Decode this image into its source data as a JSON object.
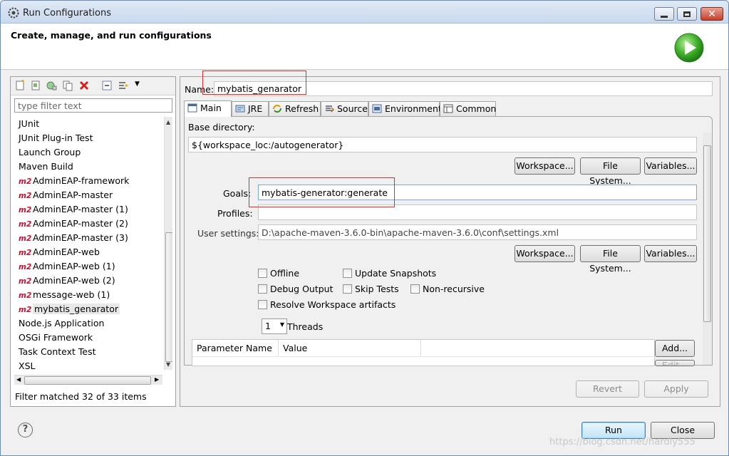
{
  "window": {
    "title": "Run Configurations",
    "header_title": "Create, manage, and run configurations"
  },
  "left": {
    "filter_placeholder": "type filter text",
    "items": [
      {
        "label": "JUnit",
        "m2": false
      },
      {
        "label": "JUnit Plug-in Test",
        "m2": false
      },
      {
        "label": "Launch Group",
        "m2": false
      },
      {
        "label": "Maven Build",
        "m2": false
      },
      {
        "label": "AdminEAP-framework",
        "m2": true
      },
      {
        "label": "AdminEAP-master",
        "m2": true
      },
      {
        "label": "AdminEAP-master (1)",
        "m2": true
      },
      {
        "label": "AdminEAP-master (2)",
        "m2": true
      },
      {
        "label": "AdminEAP-master (3)",
        "m2": true
      },
      {
        "label": "AdminEAP-web",
        "m2": true
      },
      {
        "label": "AdminEAP-web (1)",
        "m2": true
      },
      {
        "label": "AdminEAP-web (2)",
        "m2": true
      },
      {
        "label": "message-web (1)",
        "m2": true
      },
      {
        "label": "mybatis_genarator",
        "m2": true,
        "selected": true
      },
      {
        "label": "Node.js Application",
        "m2": false
      },
      {
        "label": "OSGi Framework",
        "m2": false
      },
      {
        "label": "Task Context Test",
        "m2": false
      },
      {
        "label": "XSL",
        "m2": false
      }
    ],
    "m2_badge": "m2",
    "filter_status": "Filter matched 32 of 33 items"
  },
  "right": {
    "name_label": "Name:",
    "name_value": "mybatis_genarator",
    "tabs": [
      "Main",
      "JRE",
      "Refresh",
      "Source",
      "Environment",
      "Common"
    ],
    "base_dir_label": "Base directory:",
    "base_dir_value": "${workspace_loc:/autogenerator}",
    "workspace_btn": "Workspace...",
    "filesystem_btn": "File System...",
    "variables_btn": "Variables...",
    "goals_label": "Goals:",
    "goals_value": "mybatis-generator:generate",
    "profiles_label": "Profiles:",
    "profiles_value": "",
    "user_settings_label": "User settings:",
    "user_settings_value": "D:\\apache-maven-3.6.0-bin\\apache-maven-3.6.0\\conf\\settings.xml",
    "checks": {
      "offline": "Offline",
      "update_snapshots": "Update Snapshots",
      "debug_output": "Debug Output",
      "skip_tests": "Skip Tests",
      "non_recursive": "Non-recursive",
      "resolve_workspace": "Resolve Workspace artifacts"
    },
    "threads_value": "1",
    "threads_label": "Threads",
    "param_name_header": "Parameter Name",
    "value_header": "Value",
    "add_btn": "Add...",
    "edit_btn": "Edit...",
    "revert_btn": "Revert",
    "apply_btn": "Apply"
  },
  "footer": {
    "help": "?",
    "run_btn": "Run",
    "close_btn": "Close",
    "watermark": "https://blog.csdn.net/hardly555"
  }
}
